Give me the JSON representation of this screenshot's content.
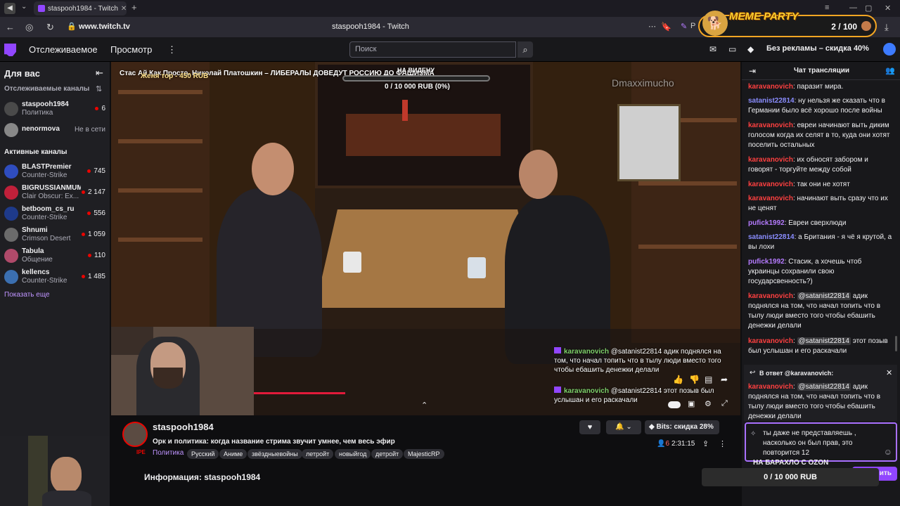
{
  "browser": {
    "tab_title": "staspooh1984 - Twitch",
    "url": "www.twitch.tv",
    "page_title": "staspooh1984 - Twitch",
    "extension_label": "Р"
  },
  "meme_widget": {
    "label": "MEME PARTY",
    "count": "2 / 100"
  },
  "twitch_nav": {
    "following": "Отслеживаемое",
    "browse": "Просмотр",
    "search_placeholder": "Поиск",
    "no_ads": "Без рекламы – скидка 40%"
  },
  "sidebar": {
    "title": "Для вас",
    "followed_title": "Отслеживаемые каналы",
    "followed": [
      {
        "name": "staspooh1984",
        "game": "Политика",
        "viewers": "6",
        "color": "#4a4a4a"
      },
      {
        "name": "nenormova",
        "status": "Не в сети",
        "color": "#888888"
      }
    ],
    "active_title": "Активные каналы",
    "active": [
      {
        "name": "BLASTPremier",
        "game": "Counter-Strike",
        "viewers": "745",
        "color": "#2f4dbf"
      },
      {
        "name": "BIGRUSSIANMUM",
        "game": "Clair Obscur: Ex...",
        "viewers": "2 147",
        "color": "#c0203a"
      },
      {
        "name": "betboom_cs_ru",
        "game": "Counter-Strike",
        "viewers": "556",
        "color": "#1e3a8a"
      },
      {
        "name": "Shnumi",
        "game": "Crimson Desert",
        "viewers": "1 059",
        "color": "#6b6b6b"
      },
      {
        "name": "Tabula",
        "game": "Общение",
        "viewers": "110",
        "color": "#b04a6a"
      },
      {
        "name": "kellencs",
        "game": "Counter-Strike",
        "viewers": "1 485",
        "color": "#3b6fb0"
      }
    ],
    "show_more": "Показать еще"
  },
  "video": {
    "ticker": "Стас Ай Как Просто. Николай Платошкин – ЛИБЕРАЛЫ ДОВЕДУТ РОССИЮ ДО ФАШИЗМА",
    "ticker_sub": "Женя тор - 450 RUB",
    "goal_title": "НА ВИДЕНУ",
    "goal_amount": "0 / 10 000 RUB (0%)",
    "watermark": "Dmaxximucho",
    "overlay_chat": [
      {
        "user": "karavanovich",
        "text": "@satanist22814 адик поднялся на том, что начал топить что в тылу люди вместо того чтобы ебашить денежки делали"
      },
      {
        "user": "karavanovich",
        "text": "@satanist22814 этот позыв был услышан и его раскачали"
      }
    ]
  },
  "stream_info": {
    "channel": "staspooh1984",
    "title": "Орк и политика: когда название стрима звучит умнее, чем весь эфир",
    "category": "Политика",
    "tags": [
      "Русский",
      "Аниме",
      "звёздныевойны",
      "летройт",
      "новыйгод",
      "детройт",
      "MajesticRP"
    ],
    "viewers": "6",
    "uptime": "2:31:15",
    "bits": "Bits: скидка 28%",
    "about": "Информация: staspooh1984"
  },
  "chat": {
    "title": "Чат трансляции",
    "messages": [
      {
        "user": "karavanovich",
        "cls": "u-red",
        "text": "паразит мира."
      },
      {
        "user": "satanist22814",
        "cls": "u-blue",
        "text": "ну нельзя же сказать что в Германии было всё хорошо после войны"
      },
      {
        "user": "karavanovich",
        "cls": "u-red",
        "text": "евреи начинают выть диким голосом когда их селят в то, куда они хотят поселить остальных"
      },
      {
        "user": "karavanovich",
        "cls": "u-red",
        "text": "их обносят забором и говорят - торгуйте между собой"
      },
      {
        "user": "karavanovich",
        "cls": "u-red",
        "text": "так они не хотят"
      },
      {
        "user": "karavanovich",
        "cls": "u-red",
        "text": "начинают выть сразу что их не ценят"
      },
      {
        "user": "pufick1992",
        "cls": "u-purple",
        "text": "Евреи сверхлюди"
      },
      {
        "user": "satanist22814",
        "cls": "u-blue",
        "text": "а Британия - я чё я крутой, а вы лохи"
      },
      {
        "user": "pufick1992",
        "cls": "u-purple",
        "text": "Стасик, а хочешь чтоб украинцы сохранили свою государсвенность?)"
      },
      {
        "user": "karavanovich",
        "cls": "u-red",
        "mention": "@satanist22814",
        "text": "адик поднялся на том, что начал топить что в тылу люди вместо того чтобы ебашить денежки делали"
      },
      {
        "user": "karavanovich",
        "cls": "u-red",
        "mention": "@satanist22814",
        "text": "этот позыв был услышан и его раскачали"
      }
    ],
    "reply_header": "В ответ @karavanovich:",
    "reply_user": "karavanovich",
    "reply_mention": "@satanist22814",
    "reply_text": "адик поднялся на том, что начал топить что в тылу люди вместо того чтобы ебашить денежки делали",
    "input_text": "ты даже не представляешь , насколько он был прав, это повторится 12",
    "bottom_banner": "НА БАРАХЛО С OZON",
    "send_label": "ить"
  },
  "bottom_goal": "0 / 10 000 RUB"
}
